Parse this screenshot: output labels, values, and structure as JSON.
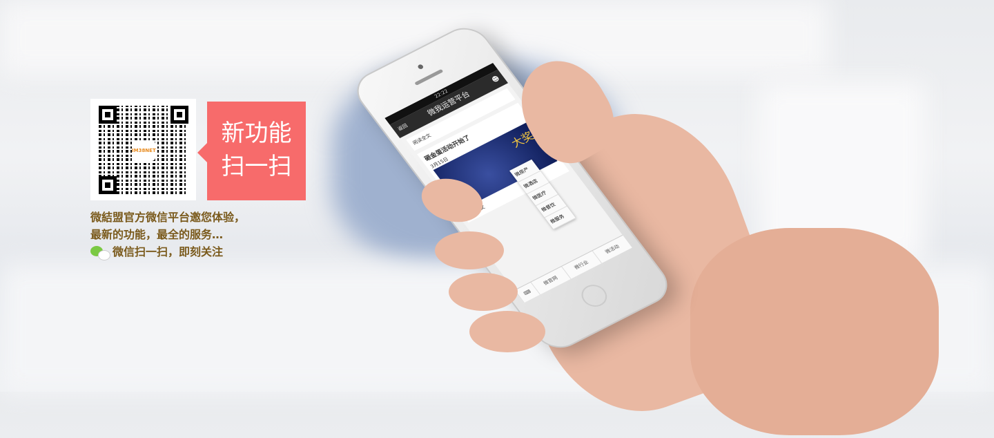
{
  "promo": {
    "badge_line1": "新功能",
    "badge_line2": "扫一扫",
    "caption_line1": "微結盟官方微信平台邀您体验，",
    "caption_line2": "最新的功能，最全的服务…",
    "caption_line3": "微信扫一扫，即刻关注",
    "qr_logo_text": "IM38NET"
  },
  "phone": {
    "status_time": "22:22",
    "nav_back": "返回",
    "nav_title": "微我运营平台",
    "read_more_1": "阅读全文",
    "article_title": "砸金蛋活动开始了",
    "article_date": "3月15日",
    "promo_image_text": "大奖",
    "read_more_2": "阅读全文",
    "menu_items": [
      "微房产",
      "微酒店",
      "微医疗",
      "微餐饮",
      "微服务"
    ],
    "tabs": [
      "微官网",
      "微行业",
      "微活动"
    ]
  },
  "colors": {
    "badge": "#f76b6b",
    "caption": "#7a5a1c"
  }
}
